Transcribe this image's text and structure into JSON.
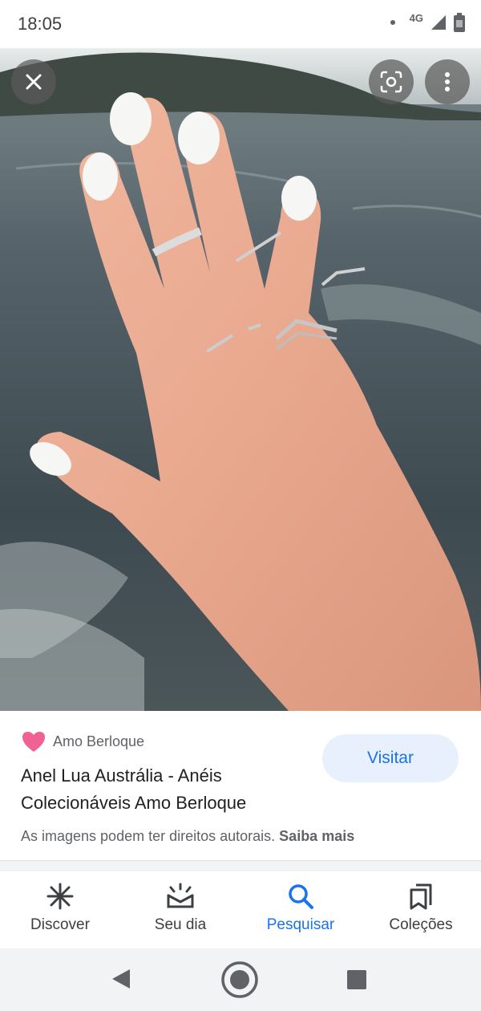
{
  "status": {
    "time": "18:05",
    "network": "4G"
  },
  "photo": {
    "alt_subject": "hand-with-rings"
  },
  "overlay": {
    "close_icon": "close-icon",
    "lens_icon": "lens-icon",
    "more_icon": "more-vert-icon"
  },
  "result": {
    "source": "Amo Berloque",
    "title": "Anel Lua Austrália - Anéis Colecionáveis Amo Berloque",
    "visit_label": "Visitar",
    "copyright_text": "As imagens podem ter direitos autorais.",
    "learn_more": "Saiba mais"
  },
  "nav": [
    {
      "label": "Discover",
      "icon": "asterisk-icon"
    },
    {
      "label": "Seu dia",
      "icon": "sunrise-icon"
    },
    {
      "label": "Pesquisar",
      "icon": "search-icon"
    },
    {
      "label": "Coleções",
      "icon": "collections-icon"
    }
  ],
  "colors": {
    "accent": "#1a73e8",
    "visit_bg": "#e8f0fe",
    "heart": "#f06292"
  }
}
